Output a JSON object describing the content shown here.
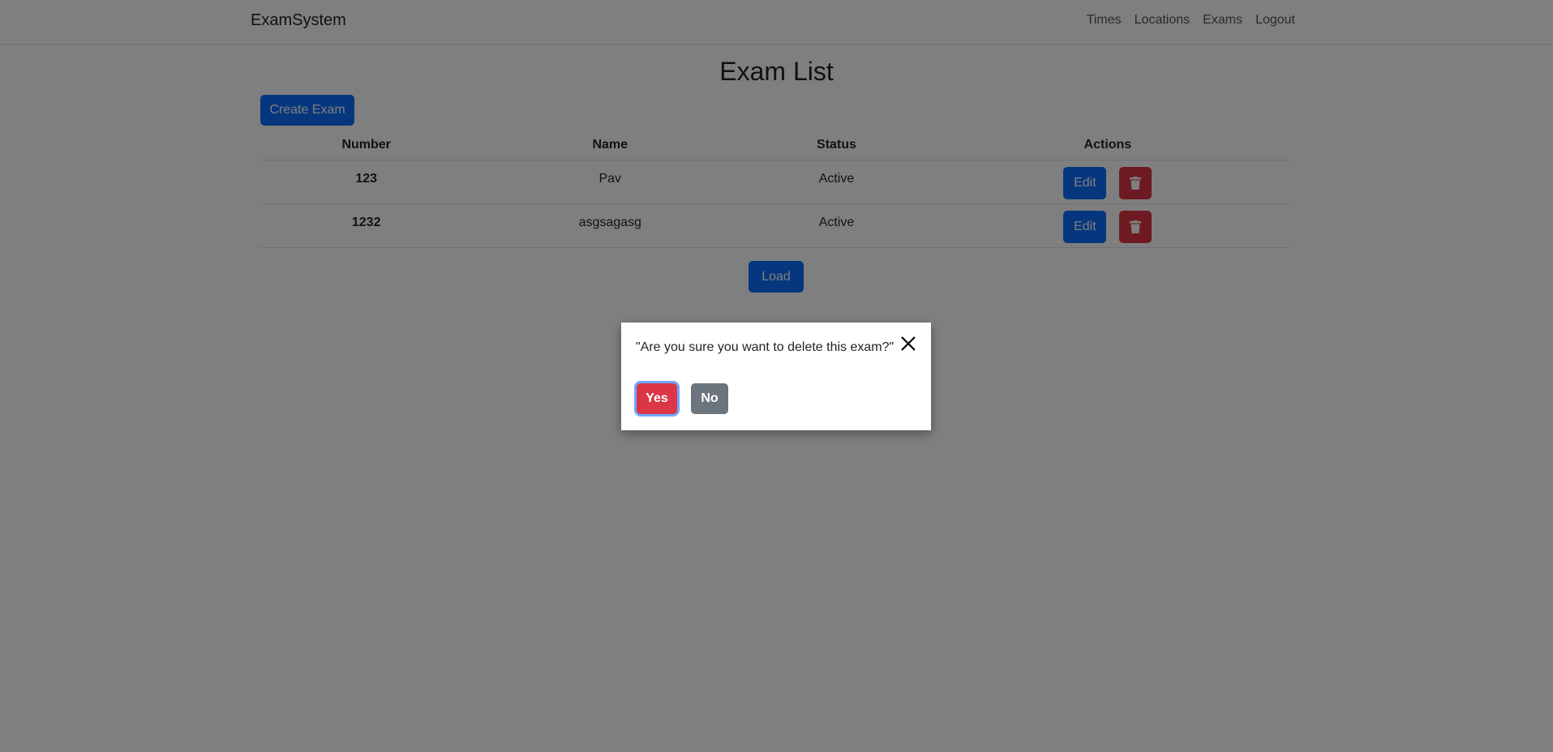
{
  "navbar": {
    "brand": "ExamSystem",
    "links": [
      "Times",
      "Locations",
      "Exams",
      "Logout"
    ]
  },
  "page": {
    "title": "Exam List",
    "create_label": "Create Exam",
    "load_label": "Load"
  },
  "table": {
    "headers": [
      "Number",
      "Name",
      "Status",
      "Actions"
    ],
    "rows": [
      {
        "number": "123",
        "name": "Pav",
        "status": "Active",
        "edit_label": "Edit"
      },
      {
        "number": "1232",
        "name": "asgsagasg",
        "status": "Active",
        "edit_label": "Edit"
      }
    ]
  },
  "dialog": {
    "message": "\"Are you sure you want to delete this exam?\"",
    "yes_label": "Yes",
    "no_label": "No"
  },
  "icons": {
    "close": "close-icon",
    "delete": "trash-icon"
  },
  "colors": {
    "primary": "#0d6efd",
    "danger": "#dc3545",
    "secondary": "#6c757d"
  }
}
